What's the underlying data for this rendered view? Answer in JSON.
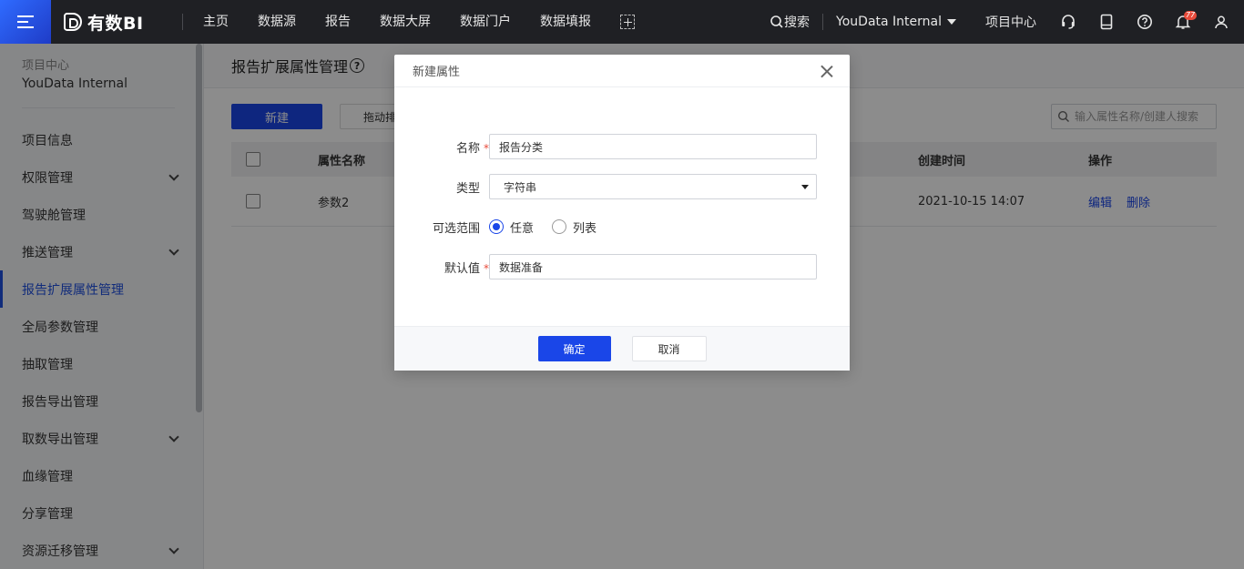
{
  "topbar": {
    "logo_text": "有数BI",
    "nav": [
      "主页",
      "数据源",
      "报告",
      "数据大屏",
      "数据门户",
      "数据填报"
    ],
    "search_label": "搜索",
    "org_name": "YouData Internal",
    "project_center": "项目中心",
    "notification_count": "77"
  },
  "sidebar": {
    "project_label": "项目中心",
    "project_name": "YouData Internal",
    "items": [
      {
        "label": "项目信息",
        "expandable": false
      },
      {
        "label": "权限管理",
        "expandable": true
      },
      {
        "label": "驾驶舱管理",
        "expandable": false
      },
      {
        "label": "推送管理",
        "expandable": true
      },
      {
        "label": "报告扩展属性管理",
        "expandable": false,
        "active": true
      },
      {
        "label": "全局参数管理",
        "expandable": false
      },
      {
        "label": "抽取管理",
        "expandable": false
      },
      {
        "label": "报告导出管理",
        "expandable": false
      },
      {
        "label": "取数导出管理",
        "expandable": true
      },
      {
        "label": "血缘管理",
        "expandable": false
      },
      {
        "label": "分享管理",
        "expandable": false
      },
      {
        "label": "资源迁移管理",
        "expandable": true
      }
    ]
  },
  "main": {
    "title": "报告扩展属性管理",
    "help_glyph": "?",
    "new_button": "新建",
    "drag_button": "拖动排序",
    "search_placeholder": "输入属性名称/创建人搜索",
    "table": {
      "headers": {
        "name": "属性名称",
        "created": "创建时间",
        "actions": "操作"
      },
      "rows": [
        {
          "name": "参数2",
          "created": "2021-10-15 14:07",
          "edit": "编辑",
          "delete": "删除"
        }
      ]
    }
  },
  "modal": {
    "title": "新建属性",
    "fields": {
      "name_label": "名称",
      "name_value": "报告分类",
      "type_label": "类型",
      "type_value": "字符串",
      "range_label": "可选范围",
      "range_options": [
        "任意",
        "列表"
      ],
      "range_selected": "任意",
      "default_label": "默认值",
      "default_value": "数据准备"
    },
    "required_mark": "*",
    "ok_button": "确定",
    "cancel_button": "取消"
  },
  "colors": {
    "accent": "#1a46e8",
    "topbar_bg": "#1f2024",
    "required": "#e84a3a"
  }
}
